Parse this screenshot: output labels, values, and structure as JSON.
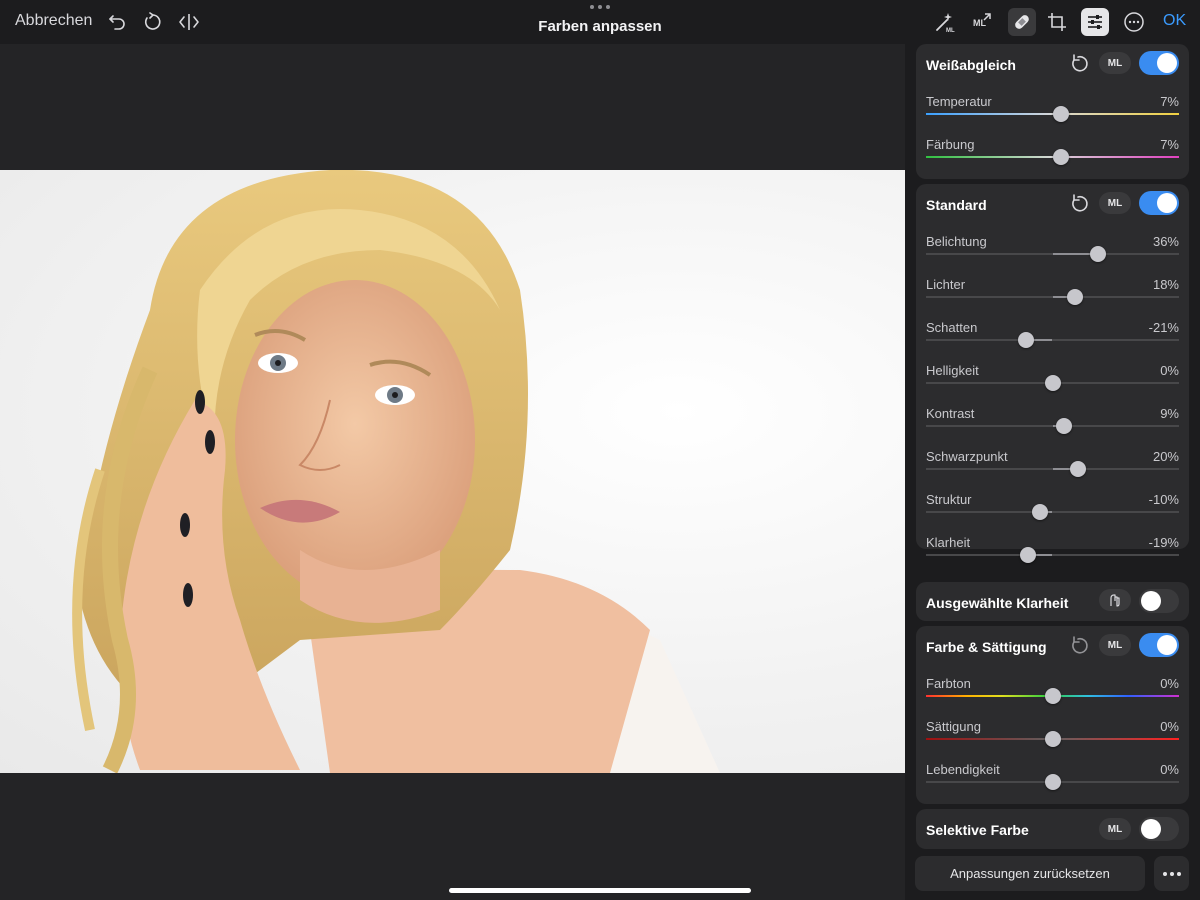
{
  "topbar": {
    "cancel_label": "Abbrechen",
    "title": "Farben anpassen",
    "ok_label": "OK"
  },
  "panel": {
    "white_balance": {
      "title": "Weißabgleich",
      "ml_label": "ML",
      "enabled": true,
      "sliders": [
        {
          "label": "Temperatur",
          "value_text": "7%",
          "value": 7,
          "gradient": "temperature"
        },
        {
          "label": "Färbung",
          "value_text": "7%",
          "value": 7,
          "gradient": "tint"
        }
      ]
    },
    "standard": {
      "title": "Standard",
      "ml_label": "ML",
      "enabled": true,
      "sliders": [
        {
          "label": "Belichtung",
          "value_text": "36%",
          "value": 36
        },
        {
          "label": "Lichter",
          "value_text": "18%",
          "value": 18
        },
        {
          "label": "Schatten",
          "value_text": "-21%",
          "value": -21
        },
        {
          "label": "Helligkeit",
          "value_text": "0%",
          "value": 0
        },
        {
          "label": "Kontrast",
          "value_text": "9%",
          "value": 9
        },
        {
          "label": "Schwarzpunkt",
          "value_text": "20%",
          "value": 20
        },
        {
          "label": "Struktur",
          "value_text": "-10%",
          "value": -10
        },
        {
          "label": "Klarheit",
          "value_text": "-19%",
          "value": -19
        }
      ]
    },
    "selective_clarity": {
      "title": "Ausgewählte Klarheit",
      "enabled": false
    },
    "color_saturation": {
      "title": "Farbe & Sättigung",
      "ml_label": "ML",
      "enabled": true,
      "sliders": [
        {
          "label": "Farbton",
          "value_text": "0%",
          "value": 0,
          "gradient": "hue"
        },
        {
          "label": "Sättigung",
          "value_text": "0%",
          "value": 0,
          "gradient": "saturation"
        },
        {
          "label": "Lebendigkeit",
          "value_text": "0%",
          "value": 0
        }
      ]
    },
    "selective_color": {
      "title": "Selektive Farbe",
      "ml_label": "ML",
      "enabled": false
    },
    "reset_all_label": "Anpassungen zurücksetzen"
  },
  "colors": {
    "accent": "#3a9bff",
    "toggle_on": "#3a8cf0",
    "panel_card": "#2c2c2e",
    "background": "#1c1c1e"
  },
  "icons": [
    "undo-icon",
    "redo-icon",
    "compare-icon",
    "magic-wand-ml-icon",
    "ml-enhance-icon",
    "healing-bandage-icon",
    "crop-icon",
    "adjust-sliders-icon",
    "more-circle-icon",
    "reset-icon",
    "brush-icon"
  ]
}
